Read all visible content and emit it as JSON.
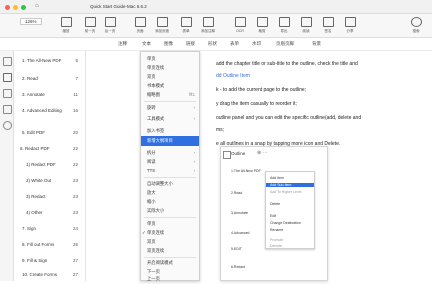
{
  "window": {
    "title": "Quick Start Guide-Mac 6.6.2",
    "home_label": "⌂"
  },
  "toolbar": {
    "zoom": "126%",
    "items": [
      "缩放",
      "前一页",
      "后一页",
      "页面",
      "添加页面",
      "表单",
      "添加注释",
      "OCR",
      "裁剪",
      "导出",
      "阅读",
      "签名",
      "分享",
      "搜索"
    ]
  },
  "subtoolbar": {
    "items": [
      "注释",
      "文本",
      "图像",
      "链接",
      "形状",
      "表单",
      "水印",
      "页眉页脚",
      "背景"
    ]
  },
  "sidebar": {
    "outline": [
      {
        "label": "1. The All-New PDF Reader Pro",
        "page": "5"
      },
      {
        "label": "2. Read",
        "page": "7"
      },
      {
        "label": "3. Annotate",
        "page": "11"
      },
      {
        "label": "4. Advanced Editing Tools",
        "page": "16"
      },
      {
        "label": "5. Edit PDF",
        "page": "20"
      },
      {
        "label": "6. Redact PDF",
        "page": "22"
      },
      {
        "label": "1) Redact PDF",
        "page": "22"
      },
      {
        "label": "2) White Out",
        "page": "23"
      },
      {
        "label": "3) Redact",
        "page": "23"
      },
      {
        "label": "4) Other",
        "page": "23"
      },
      {
        "label": "7. Sign",
        "page": "24"
      },
      {
        "label": "8. Fill out Forms",
        "page": "26"
      },
      {
        "label": "9. Fill & Sign",
        "page": "27"
      },
      {
        "label": "10. Create Forms",
        "page": "27"
      }
    ]
  },
  "document": {
    "lines": [
      {
        "text": "add the chapter title or sub-title to the outline, check the title and"
      },
      {
        "text": "dd Outline Item",
        "link": true
      },
      {
        "text": "k - to add the current page to the outline;"
      },
      {
        "text": "y drag the item casually to reorder it;"
      },
      {
        "text": "outline panel and you can edit the specific outline(add, delete and"
      },
      {
        "text": "ms;"
      },
      {
        "text": "e all outlines in a snap by tapping more icon and Delete."
      }
    ]
  },
  "view_menu": {
    "items": [
      {
        "label": "单页",
        "arrow": false
      },
      {
        "label": "单页连续",
        "arrow": false
      },
      {
        "label": "双页",
        "arrow": false
      },
      {
        "label": "书本模式",
        "arrow": false
      },
      {
        "label": "缩略图",
        "short": "⌘1",
        "arrow": false
      },
      {
        "label": "旋转",
        "arrow": true
      },
      {
        "label": "工具模式",
        "arrow": true
      },
      {
        "label": "加入书签",
        "arrow": false
      },
      {
        "label": "新增大纲项目",
        "selected": true,
        "arrow": false
      },
      {
        "label": "拆分",
        "arrow": true
      },
      {
        "label": "阅读",
        "arrow": true
      },
      {
        "label": "TTS",
        "arrow": true
      },
      {
        "label": "自动调整大小",
        "arrow": false
      },
      {
        "label": "放大",
        "arrow": false
      },
      {
        "label": "缩小",
        "arrow": false
      },
      {
        "label": "实际大小",
        "arrow": false
      },
      {
        "label": "单页",
        "arrow": false
      },
      {
        "label": "单页连续",
        "checked": true,
        "arrow": false
      },
      {
        "label": "双页",
        "arrow": false
      },
      {
        "label": "双页连续",
        "arrow": false
      },
      {
        "label": "开启阅读模式",
        "arrow": false
      },
      {
        "label": "下一页",
        "arrow": false
      },
      {
        "label": "上一页",
        "arrow": false
      },
      {
        "label": "自动滚动",
        "arrow": false
      }
    ]
  },
  "thumb_panel": {
    "header": "Outline",
    "rows": [
      "1.The All-New PDF Reader Pro",
      "2.Read",
      "3.Annotate",
      "4.Advanced",
      "5.EDIT",
      "6.Redact"
    ]
  },
  "context_menu": {
    "items": [
      "Add Item",
      "Add Sub-Item",
      "Add To Higher Level",
      "Delete",
      "Edit",
      "Change Destination",
      "Rename",
      "Promote",
      "Demote"
    ],
    "selected_index": 1
  },
  "colors": {
    "accent": "#2f6fe0",
    "link": "#3b6fd9"
  }
}
